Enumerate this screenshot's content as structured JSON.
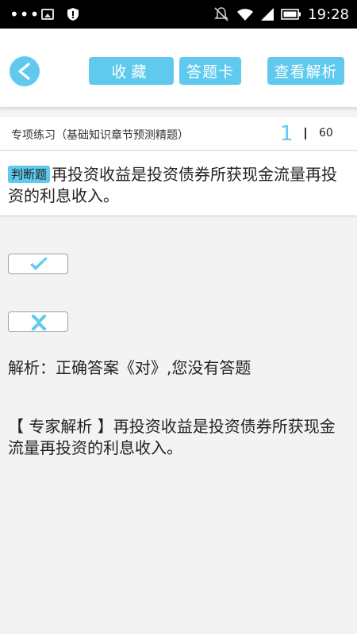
{
  "status_bar": {
    "time": "19:28",
    "icons": [
      "more-dots-icon",
      "image-icon",
      "shield-icon",
      "silent-icon",
      "wifi-icon",
      "signal-icon",
      "battery-icon"
    ]
  },
  "header": {
    "back_icon": "back-arrow-icon",
    "favorite_label": "收藏",
    "answer_card_label": "答题卡",
    "view_analysis_label": "查看解析"
  },
  "subheader": {
    "title": "专项练习（基础知识章节预测精题）",
    "current_page": "1",
    "total_pages": "60"
  },
  "question": {
    "type_label": "判断题",
    "text": "再投资收益是投资债券所获现金流量再投资的利息收入。"
  },
  "options": {
    "true_icon": "check-icon",
    "false_icon": "x-icon"
  },
  "analysis": {
    "text": "解析：正确答案《对》,您没有答题"
  },
  "expert": {
    "text": "【 专家解析 】再投资收益是投资债券所获现金流量再投资的利息收入。"
  },
  "colors": {
    "accent": "#5fc9ee",
    "background": "#f3f3f3",
    "status_bar": "#000000"
  }
}
